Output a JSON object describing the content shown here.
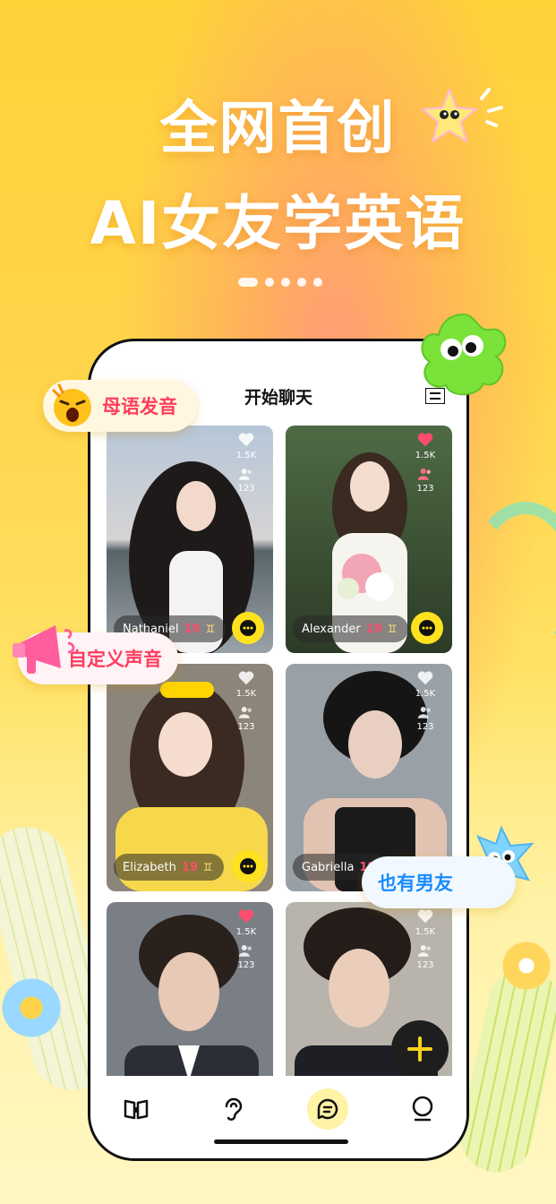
{
  "hero": {
    "line1": "全网首创",
    "line2": "AI女友学英语",
    "dots_total": 5,
    "dots_active": 1
  },
  "app": {
    "title": "开始聊天",
    "icons": {
      "menu": "menu-icon",
      "fab": "plus-icon"
    },
    "accent": "#FFE21F"
  },
  "cards": [
    {
      "name": "Nathaniel",
      "age": "19",
      "zodiac": "♊",
      "likes": "1.5K",
      "users": "123",
      "liked": false
    },
    {
      "name": "Alexander",
      "age": "19",
      "zodiac": "♊",
      "likes": "1.5K",
      "users": "123",
      "liked": true
    },
    {
      "name": "Elizabeth",
      "age": "19",
      "zodiac": "♊",
      "likes": "1.5K",
      "users": "123",
      "liked": false
    },
    {
      "name": "Gabriella",
      "age": "19",
      "zodiac": "♊",
      "likes": "1.5K",
      "users": "123",
      "liked": false
    },
    {
      "name": "",
      "age": "",
      "zodiac": "",
      "likes": "1.5K",
      "users": "123",
      "liked": true
    },
    {
      "name": "",
      "age": "",
      "zodiac": "",
      "likes": "1.5K",
      "users": "123",
      "liked": false
    }
  ],
  "bubbles": {
    "native": "母语发音",
    "custom_voice": "自定义声音",
    "boyfriend": "也有男友"
  },
  "tabs": [
    {
      "icon": "book-icon",
      "active": false
    },
    {
      "icon": "ear-icon",
      "active": false
    },
    {
      "icon": "chat-icon",
      "active": true
    },
    {
      "icon": "profile-icon",
      "active": false
    }
  ]
}
